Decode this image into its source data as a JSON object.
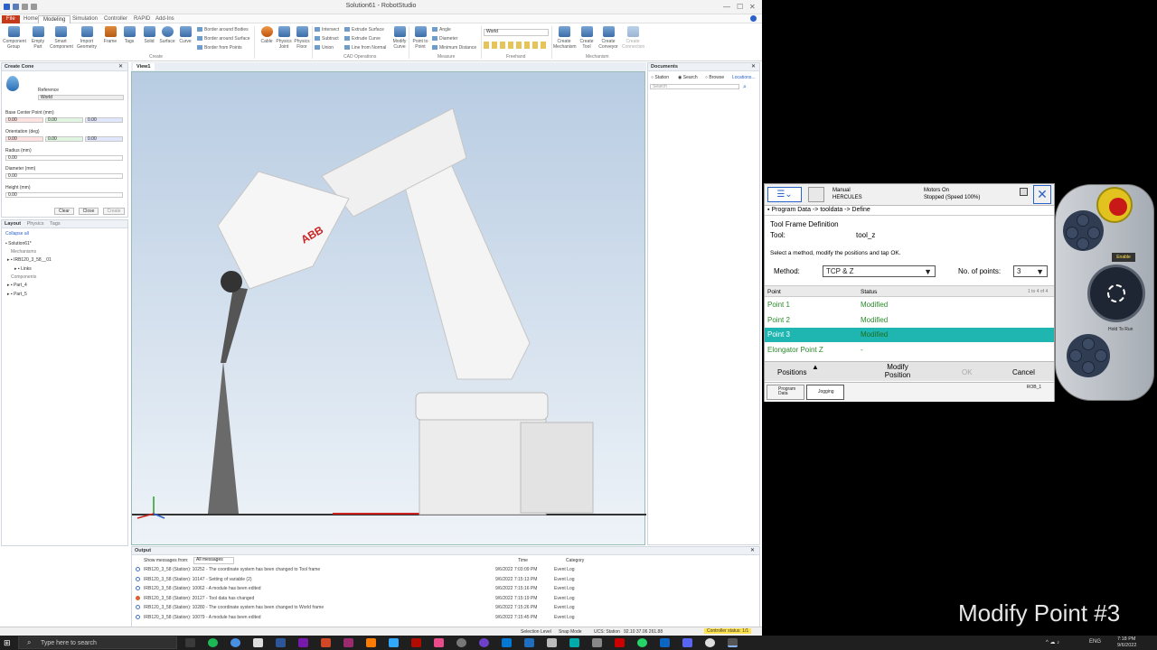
{
  "app": {
    "title": "Solution61 - RobotStudio"
  },
  "menu_tabs": [
    "File",
    "Home",
    "Modeling",
    "Simulation",
    "Controller",
    "RAPID",
    "Add-Ins"
  ],
  "ribbon": {
    "create_buttons": [
      {
        "label": "Component Group"
      },
      {
        "label": "Empty Part"
      },
      {
        "label": "Smart Component"
      },
      {
        "label": "Import Geometry"
      },
      {
        "label": "Frame"
      },
      {
        "label": "Tags"
      }
    ],
    "solid_buttons": [
      {
        "label": "Solid"
      },
      {
        "label": "Surface"
      },
      {
        "label": "Curve"
      }
    ],
    "border_items": [
      "Border around Bodies",
      "Border around Surface",
      "Border from Points"
    ],
    "create_label": "Create",
    "physics_buttons": [
      {
        "label": "Cable"
      },
      {
        "label": "Physics Joint"
      },
      {
        "label": "Physics Floor"
      }
    ],
    "cad_items": [
      "Intersect",
      "Subtract",
      "Union"
    ],
    "cad_items2": [
      "Extrude Surface",
      "Extrude Curve",
      "Line from Normal"
    ],
    "modify_curve": "Modify Curve",
    "cad_label": "CAD Operations",
    "point_in_point": "Point to Point",
    "measure_items": [
      "Angle",
      "Diameter",
      "Minimum Distance"
    ],
    "measure_label": "Measure",
    "freehand_ref": "World",
    "freehand_label": "Freehand",
    "mechanism_buttons": [
      {
        "label": "Create Mechanism"
      },
      {
        "label": "Create Tool"
      },
      {
        "label": "Create Conveyor"
      },
      {
        "label": "Create Connection"
      }
    ],
    "mechanism_label": "Mechanism"
  },
  "create_cone": {
    "title": "Create Cone",
    "reference_label": "Reference",
    "reference_value": "World",
    "base_center_label": "Base Center Point (mm)",
    "base_center": [
      "0.00",
      "0.00",
      "0.00"
    ],
    "orientation_label": "Orientation (deg)",
    "orientation": [
      "0.00",
      "0.00",
      "0.00"
    ],
    "radius_label": "Radius (mm)",
    "radius": "0.00",
    "diameter_label": "Diameter (mm)",
    "diameter": "0.00",
    "height_label": "Height (mm)",
    "height": "0.00",
    "clear": "Clear",
    "close": "Close",
    "create": "Create"
  },
  "layout_panel": {
    "tabs": [
      "Layout",
      "Physics",
      "Tags"
    ],
    "collapse_all": "Collapse all",
    "station": "Solution61*",
    "mechanisms": "Mechanisms",
    "robot": "IRB120_3_58__01",
    "links": "Links",
    "components": "Components",
    "parts": [
      "Part_4",
      "Part_5"
    ]
  },
  "view": {
    "tab": "View1"
  },
  "documents": {
    "title": "Documents",
    "opt_station": "Station",
    "opt_search": "Search",
    "opt_browse": "Browse",
    "locations": "Locations...",
    "search_placeholder": "Search"
  },
  "output": {
    "title": "Output",
    "show_label": "Show messages from:",
    "filter": "All messages",
    "col_time": "Time",
    "col_category": "Category",
    "rows": [
      {
        "msg": "IRB120_3_58 (Station): 10252 - The coordinate system has been changed to Tool frame",
        "time": "9/6/2022 7:03:09 PM",
        "cat": "Event Log"
      },
      {
        "msg": "IRB120_3_58 (Station): 10147 - Setting of variable (2)",
        "time": "9/6/2022 7:15:13 PM",
        "cat": "Event Log"
      },
      {
        "msg": "IRB120_3_58 (Station): 10062 - A module has been edited",
        "time": "9/6/2022 7:15:16 PM",
        "cat": "Event Log"
      },
      {
        "msg": "IRB120_3_58 (Station): 20127 - Tool data has changed",
        "time": "9/6/2022 7:15:19 PM",
        "cat": "Event Log"
      },
      {
        "msg": "IRB120_3_58 (Station): 10280 - The coordinate system has been changed to World frame",
        "time": "9/6/2022 7:15:26 PM",
        "cat": "Event Log"
      },
      {
        "msg": "IRB120_3_58 (Station): 10079 - A module has been edited",
        "time": "9/6/2022 7:15:45 PM",
        "cat": "Event Log"
      }
    ]
  },
  "statusbar": {
    "selection": "Selection Level",
    "snap": "Snap Mode",
    "ucs": "UCS: Station",
    "coords": "92.10  37.06  261.88",
    "controller": "Controller status: 1/1"
  },
  "flexpendant": {
    "mode": "Manual",
    "system": "HERCULES",
    "motors": "Motors On",
    "stopped": "Stopped (Speed 100%)",
    "breadcrumb": "Program Data -> tooldata -> Define",
    "section_title": "Tool Frame Definition",
    "tool_label": "Tool:",
    "tool_value": "tool_z",
    "instruction": "Select a method, modify the positions and tap OK.",
    "method_label": "Method:",
    "method_value": "TCP & Z",
    "points_label": "No. of points:",
    "points_value": "3",
    "col_point": "Point",
    "col_status": "Status",
    "range": "1 to 4 of 4",
    "rows": [
      {
        "point": "Point  1",
        "status": "Modified",
        "selected": false
      },
      {
        "point": "Point  2",
        "status": "Modified",
        "selected": false
      },
      {
        "point": "Point  3",
        "status": "Modified",
        "selected": true
      },
      {
        "point": "Elongator Point  Z",
        "status": "-",
        "selected": false
      }
    ],
    "positions": "Positions",
    "modify_position": "Modify Position",
    "ok": "OK",
    "cancel": "Cancel",
    "task_program": "Program Data",
    "task_jogging": "Jogging",
    "rob_label": "ROB_1",
    "enable": "Enable",
    "hold": "Hold To Run"
  },
  "taskbar": {
    "search_placeholder": "Type here to search",
    "lang": "ENG",
    "time": "7:18 PM",
    "date": "9/6/2022"
  },
  "caption": "Modify Point #3",
  "colors": {
    "accent": "#c43b1c",
    "selected_row": "#1fb5b0",
    "modified_text": "#2a8a2a"
  }
}
